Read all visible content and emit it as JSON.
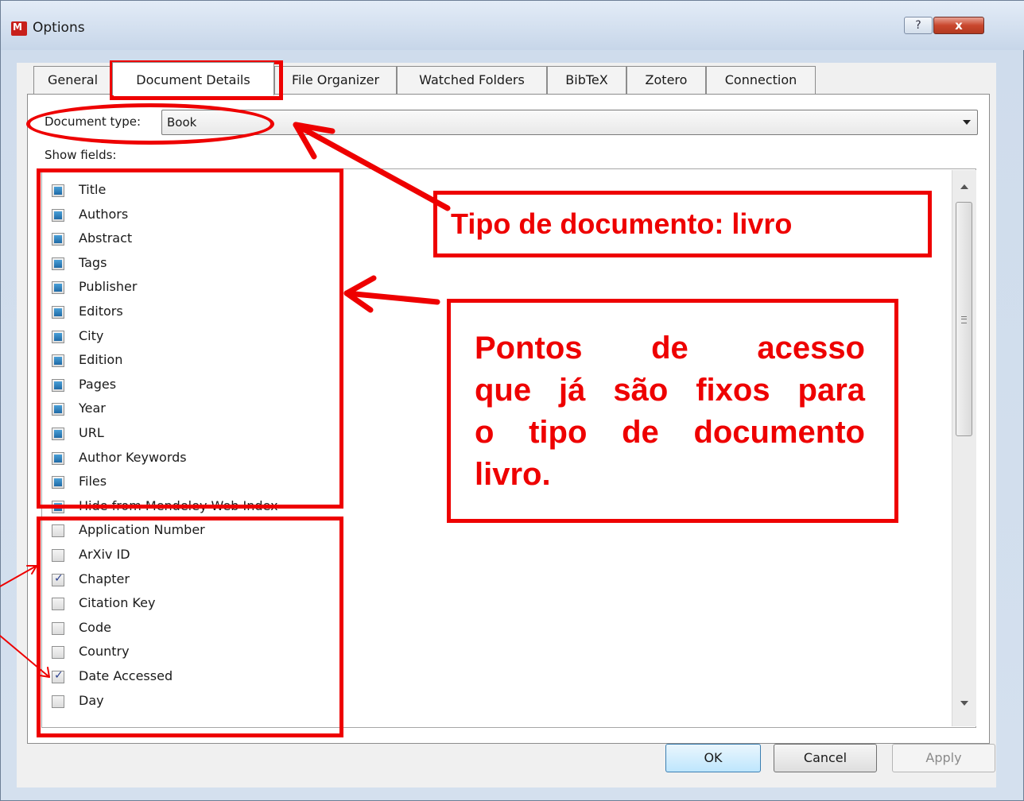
{
  "window": {
    "title": "Options",
    "help_label": "?",
    "close_label": "x"
  },
  "tabs": [
    {
      "label": "General"
    },
    {
      "label": "Document Details"
    },
    {
      "label": "File Organizer"
    },
    {
      "label": "Watched Folders"
    },
    {
      "label": "BibTeX"
    },
    {
      "label": "Zotero"
    },
    {
      "label": "Connection"
    }
  ],
  "active_tab": "Document Details",
  "document_type": {
    "label": "Document type:",
    "value": "Book"
  },
  "show_fields": {
    "label": "Show fields:",
    "items": [
      {
        "label": "Title",
        "state": "fixed"
      },
      {
        "label": "Authors",
        "state": "fixed"
      },
      {
        "label": "Abstract",
        "state": "fixed"
      },
      {
        "label": "Tags",
        "state": "fixed"
      },
      {
        "label": "Publisher",
        "state": "fixed"
      },
      {
        "label": "Editors",
        "state": "fixed"
      },
      {
        "label": "City",
        "state": "fixed"
      },
      {
        "label": "Edition",
        "state": "fixed"
      },
      {
        "label": "Pages",
        "state": "fixed"
      },
      {
        "label": "Year",
        "state": "fixed"
      },
      {
        "label": "URL",
        "state": "fixed"
      },
      {
        "label": "Author Keywords",
        "state": "fixed"
      },
      {
        "label": "Files",
        "state": "fixed"
      },
      {
        "label": "Hide from Mendeley Web Index",
        "state": "fixed"
      },
      {
        "label": "Application Number",
        "state": "unchecked"
      },
      {
        "label": "ArXiv ID",
        "state": "unchecked"
      },
      {
        "label": "Chapter",
        "state": "checked"
      },
      {
        "label": "Citation Key",
        "state": "unchecked"
      },
      {
        "label": "Code",
        "state": "unchecked"
      },
      {
        "label": "Country",
        "state": "unchecked"
      },
      {
        "label": "Date Accessed",
        "state": "checked"
      },
      {
        "label": "Day",
        "state": "unchecked"
      }
    ]
  },
  "buttons": {
    "ok": "OK",
    "cancel": "Cancel",
    "apply": "Apply"
  },
  "annotations": {
    "callout_type": "Tipo de documento: livro",
    "callout_fields_lines": [
      "Pontos de acesso",
      "que já são fixos para",
      "o tipo de documento",
      "livro."
    ],
    "color": "#ee0000"
  },
  "colors": {
    "accent_checkbox": "#1f6aa6",
    "close_button": "#c9472e",
    "annotation": "#ee0000"
  }
}
